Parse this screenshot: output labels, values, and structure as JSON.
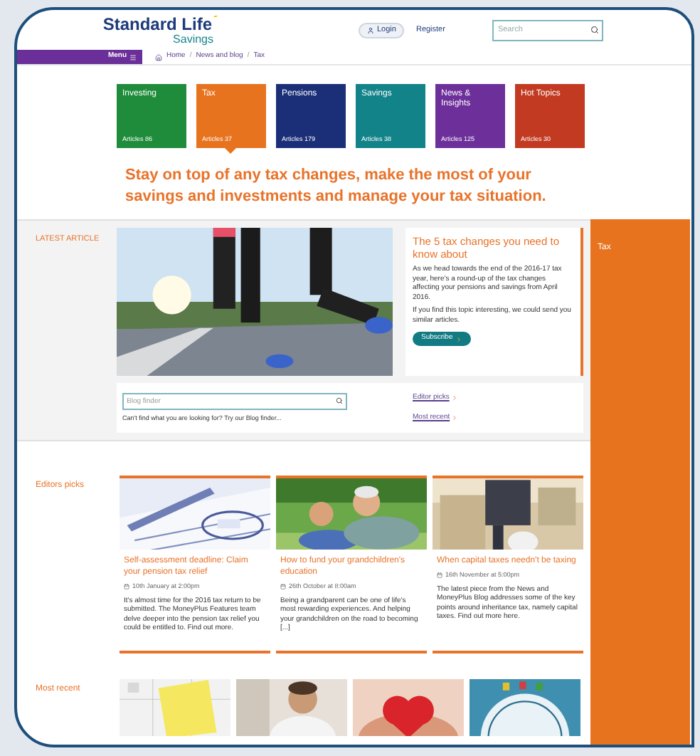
{
  "header": {
    "logo": {
      "name": "Standard Life",
      "sub": "Savings"
    },
    "login": "Login",
    "register": "Register",
    "search": {
      "placeholder": "Search"
    }
  },
  "nav": {
    "menu": "Menu",
    "breadcrumb": {
      "separator": "/",
      "items": [
        "Home",
        "News and blog",
        "Tax"
      ]
    }
  },
  "categories": [
    {
      "name": "Investing",
      "count": "Articles 86",
      "color": "#1e8c3a",
      "selected": false
    },
    {
      "name": "Tax",
      "count": "Articles 37",
      "color": "#e8731f",
      "selected": true
    },
    {
      "name": "Pensions",
      "count": "Articles 179",
      "color": "#1b2f78",
      "selected": false
    },
    {
      "name": "Savings",
      "count": "Articles 38",
      "color": "#13838a",
      "selected": false
    },
    {
      "name": "News & Insights",
      "count": "Articles 125",
      "color": "#6d2f9a",
      "selected": false
    },
    {
      "name": "Hot Topics",
      "count": "Articles 30",
      "color": "#c23a22",
      "selected": false
    }
  ],
  "headline": "Stay on top of any tax changes, make the most of your savings and investments and manage your tax situation.",
  "latest": {
    "label": "LATEST ARTICLE",
    "article": {
      "title": "The 5 tax changes you need to know about",
      "paragraphs": [
        "As we head towards the end of the 2016-17 tax year, here's a round-up of the tax changes affecting your pensions and savings from April 2016.",
        "If you find this topic interesting, we could send you similar articles."
      ],
      "button": "Subscribe"
    },
    "finder": {
      "placeholder": "Blog finder",
      "hint": "Can't find what you are looking for? Try our Blog finder...",
      "links": [
        "Editor picks",
        "Most recent"
      ]
    }
  },
  "sidebar": {
    "title": "Tax"
  },
  "editors_picks": {
    "label": "Editors picks",
    "articles": [
      {
        "title": "Self-assessment deadline: Claim your pension tax relief",
        "date": "10th January at 2:00pm",
        "text": "It's almost time for the 2016 tax return to be submitted. The MoneyPlus Features team delve deeper into the pension tax relief you could be entitled to. Find out more."
      },
      {
        "title": "How to fund your grandchildren's education",
        "date": "26th October at 8:00am",
        "text": "Being a grandparent can be one of life's most rewarding experiences. And helping your grandchildren on the road to becoming [...]"
      },
      {
        "title": "When capital taxes needn't be taxing",
        "date": "16th November at 5:00pm",
        "text": "The latest piece from the News and MoneyPlus Blog addresses some of the key points around inheritance tax, namely capital taxes. Find out more here."
      }
    ]
  },
  "most_recent": {
    "label": "Most recent"
  }
}
